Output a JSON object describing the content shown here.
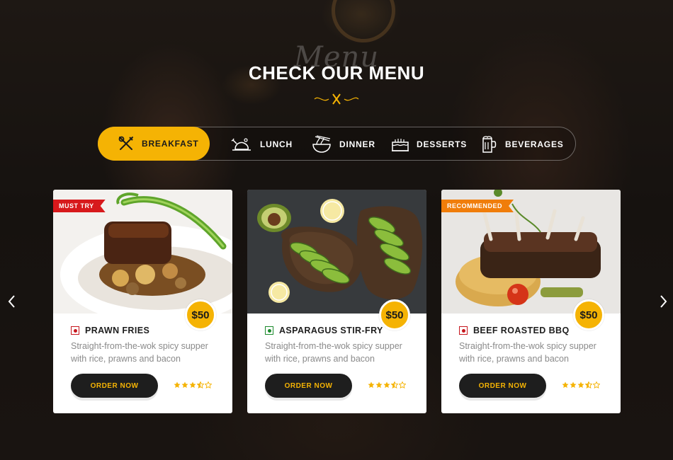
{
  "header": {
    "watermark": "Menu",
    "title": "CHECK OUR MENU"
  },
  "tabs": [
    {
      "label": "BREAKFAST",
      "icon": "fork-knife-icon",
      "active": true
    },
    {
      "label": "LUNCH",
      "icon": "roast-chicken-icon",
      "active": false
    },
    {
      "label": "DINNER",
      "icon": "noodle-bowl-icon",
      "active": false
    },
    {
      "label": "DESSERTS",
      "icon": "cake-icon",
      "active": false
    },
    {
      "label": "BEVERAGES",
      "icon": "beverage-icon",
      "active": false
    }
  ],
  "cards": [
    {
      "ribbon": "MUST TRY",
      "ribbon_color": "#d7191c",
      "price": "$50",
      "veg": false,
      "name": "PRAWN FRIES",
      "description": "Straight-from-the-wok spicy supper with rice, prawns and bacon",
      "button": "ORDER NOW",
      "rating": 3.5,
      "rating_max": 5
    },
    {
      "ribbon": "",
      "ribbon_color": "",
      "price": "$50",
      "veg": true,
      "name": "ASPARAGUS STIR-FRY",
      "description": "Straight-from-the-wok spicy supper with rice, prawns and bacon",
      "button": "ORDER NOW",
      "rating": 3.5,
      "rating_max": 5
    },
    {
      "ribbon": "RECOMMENDED",
      "ribbon_color": "#f07d0a",
      "price": "$50",
      "veg": false,
      "name": "BEEF ROASTED BBQ",
      "description": "Straight-from-the-wok spicy supper with rice, prawns and bacon",
      "button": "ORDER NOW",
      "rating": 3.5,
      "rating_max": 5
    }
  ],
  "colors": {
    "accent": "#f5b304",
    "dark": "#1e1e1e",
    "veg": "#1b8a2c",
    "non_veg": "#c6161d"
  }
}
